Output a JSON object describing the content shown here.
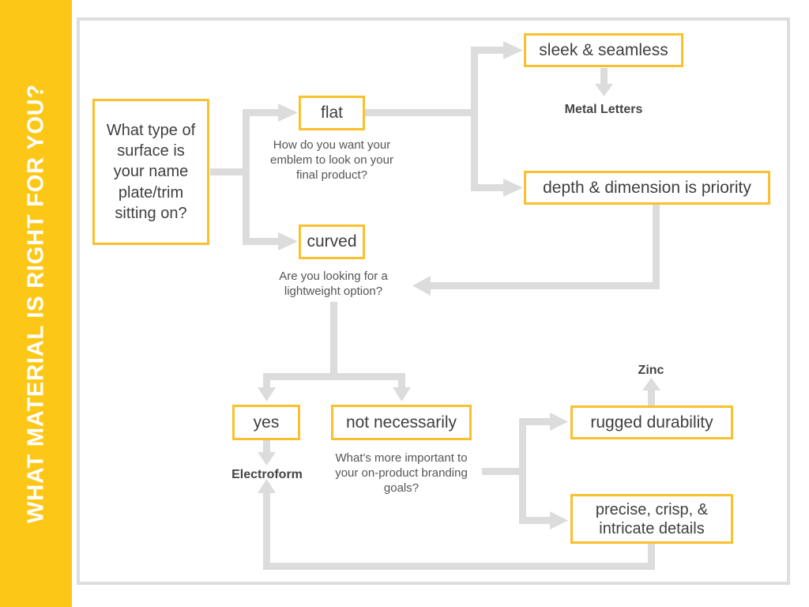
{
  "sidebar": {
    "title": "WHAT MATERIAL IS RIGHT FOR YOU?",
    "background_color": "#FDC717",
    "text_color": "#FFFFFF"
  },
  "theme": {
    "box_border_color": "#FBC02D",
    "connector_color": "#DCDCDC",
    "frame_color": "#DEDEDE",
    "text_color": "#3F3F3F",
    "caption_color": "#555555",
    "outcome_color": "#444444"
  },
  "nodes": {
    "start": "What type of surface is your name plate/trim sitting on?",
    "flat": "flat",
    "curved": "curved",
    "sleek": "sleek & seamless",
    "depth": "depth & dimension is priority",
    "yes": "yes",
    "not_necessarily": "not necessarily",
    "rugged": "rugged durability",
    "precise": "precise, crisp, & intricate details"
  },
  "captions": {
    "flat_question": "How do you want your emblem to look on your final product?",
    "curved_question": "Are you looking for a lightweight option?",
    "branding_question": "What's more important to your on-product branding goals?"
  },
  "outcomes": {
    "metal_letters": "Metal Letters",
    "electroform": "Electroform",
    "zinc": "Zinc"
  }
}
